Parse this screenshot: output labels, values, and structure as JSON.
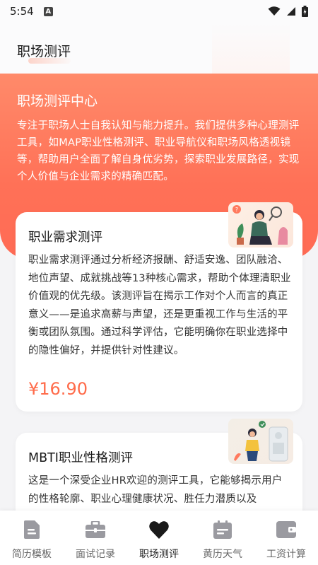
{
  "status": {
    "time": "5:54"
  },
  "header": {
    "title": "职场测评"
  },
  "banner": {
    "title": "职场测评中心",
    "description": "专注于职场人士自我认知与能力提升。我们提供多种心理测评工具，如MAP职业性格测评、职业导航仪和职场风格透视镜等，帮助用户全面了解自身优劣势，探索职业发展路径，实现个人价值与企业需求的精确匹配。"
  },
  "cards": [
    {
      "title": "职业需求测评",
      "description": "职业需求测评通过分析经济报酬、舒适安逸、团队融洽、地位声望、成就挑战等13种核心需求，帮助个体理清职业价值观的优先级。该测评旨在揭示工作对个人而言的真正意义——是追求高薪与声望，还是更重视工作与生活的平衡或团队氛围。通过科学评估，它能明确你在职业选择中的隐性偏好，并提供针对性建议。",
      "price": "¥16.90"
    },
    {
      "title": "MBTI职业性格测评",
      "description": "这是一个深受企业HR欢迎的测评工具，它能够揭示用户的性格轮廓、职业心理健康状况、胜任力潜质以及"
    }
  ],
  "nav": {
    "items": [
      {
        "label": "简历模板",
        "icon": "resume-icon"
      },
      {
        "label": "面试记录",
        "icon": "briefcase-icon"
      },
      {
        "label": "职场测评",
        "icon": "heart-icon"
      },
      {
        "label": "黄历天气",
        "icon": "calendar-icon"
      },
      {
        "label": "工资计算",
        "icon": "wallet-icon"
      }
    ],
    "active_index": 2
  },
  "colors": {
    "accent": "#ff6b4a",
    "banner": "#ff7a5e"
  }
}
